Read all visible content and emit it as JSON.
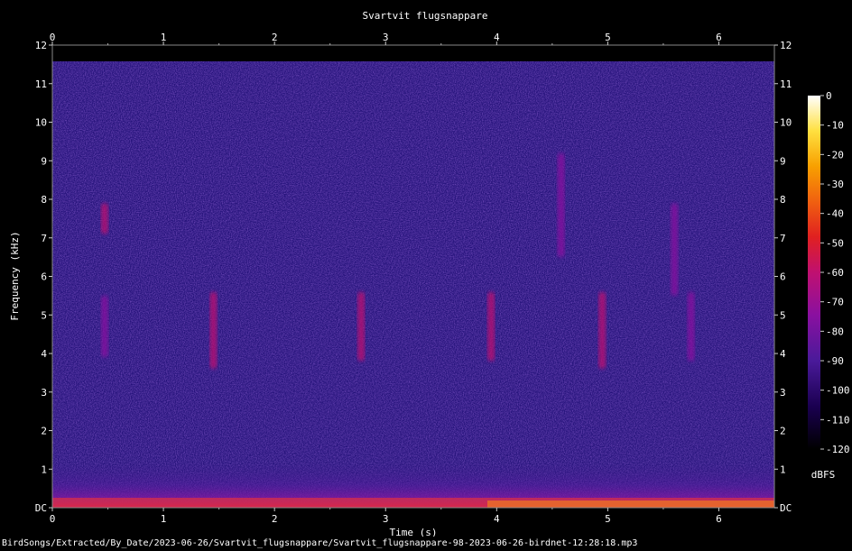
{
  "chart_data": {
    "type": "heatmap",
    "title": "Svartvit flugsnappare",
    "xlabel": "Time (s)",
    "ylabel": "Frequency (kHz)",
    "xlim": [
      0,
      6.5
    ],
    "ylim": [
      0,
      12
    ],
    "x_ticks": [
      "0",
      "1",
      "2",
      "3",
      "4",
      "5",
      "6"
    ],
    "y_ticks": [
      "DC",
      "1",
      "2",
      "3",
      "4",
      "5",
      "6",
      "7",
      "8",
      "9",
      "10",
      "11",
      "12"
    ],
    "colorbar": {
      "label": "dBFS",
      "range": [
        -120,
        0
      ],
      "ticks": [
        "0",
        "-10",
        "-20",
        "-30",
        "-40",
        "-50",
        "-60",
        "-70",
        "-80",
        "-90",
        "-100",
        "-110",
        "-120"
      ],
      "colors": [
        "#000000",
        "#1a0050",
        "#4a1a9a",
        "#8a10a0",
        "#c01070",
        "#e02020",
        "#f06010",
        "#f8a000",
        "#ffe040",
        "#ffffff"
      ]
    },
    "background_level_dbfs": -100,
    "calls": [
      {
        "t": 0.47,
        "f_low": 7.1,
        "f_high": 7.9,
        "level": -70
      },
      {
        "t": 0.47,
        "f_low": 3.9,
        "f_high": 5.5,
        "level": -75
      },
      {
        "t": 1.45,
        "f_low": 3.6,
        "f_high": 5.6,
        "level": -72
      },
      {
        "t": 2.78,
        "f_low": 3.8,
        "f_high": 5.6,
        "level": -73
      },
      {
        "t": 3.95,
        "f_low": 3.8,
        "f_high": 5.6,
        "level": -72
      },
      {
        "t": 4.58,
        "f_low": 6.5,
        "f_high": 9.2,
        "level": -82
      },
      {
        "t": 4.95,
        "f_low": 3.6,
        "f_high": 5.6,
        "level": -73
      },
      {
        "t": 5.75,
        "f_low": 3.8,
        "f_high": 5.6,
        "level": -74
      },
      {
        "t": 5.6,
        "f_low": 5.5,
        "f_high": 7.9,
        "level": -78
      }
    ],
    "low_band": {
      "f_high": 1.2,
      "level": -80
    }
  },
  "footer": {
    "path": "BirdSongs/Extracted/By_Date/2023-06-26/Svartvit_flugsnappare/Svartvit_flugsnappare-98-2023-06-26-birdnet-12:28:18.mp3"
  }
}
